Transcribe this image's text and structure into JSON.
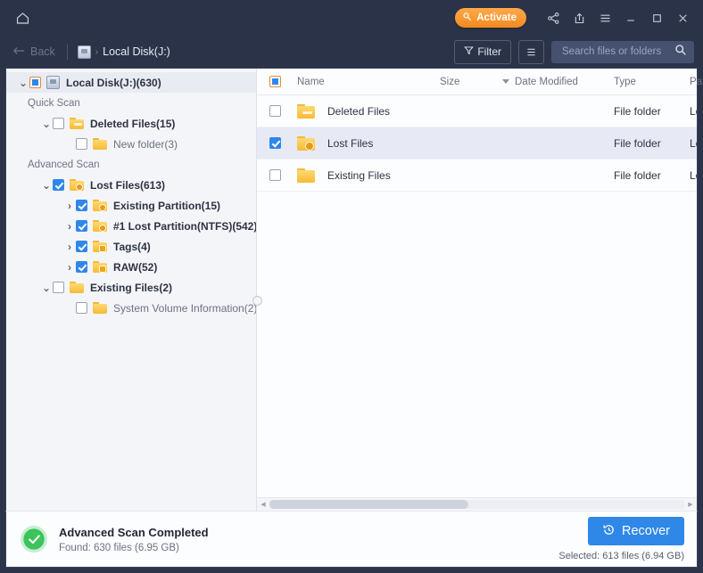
{
  "titlebar": {
    "home_icon": "home-icon",
    "activate_label": "Activate",
    "activate_icon": "key-icon",
    "activate_color": "#f58a1f",
    "share_icon": "share-icon",
    "export_icon": "upload-icon",
    "menu_icon": "hamburger-icon",
    "minimize_icon": "minimize-icon",
    "maximize_icon": "maximize-icon",
    "close_icon": "close-icon"
  },
  "toolbar": {
    "back_label": "Back",
    "back_icon": "arrow-left-icon",
    "breadcrumb": "Local Disk(J:)",
    "breadcrumb_icon": "hard-disk-icon",
    "breadcrumb_separator": "›",
    "filter_label": "Filter",
    "filter_icon": "funnel-icon",
    "view_icon": "list-view-icon",
    "search_placeholder": "Search files or folders",
    "search_value": "",
    "search_icon": "magnifier-icon"
  },
  "sidebar": {
    "root": {
      "label": "Local Disk(J:)(630)",
      "chevron": "⌄",
      "check_state": "indeterminate",
      "icon": "hard-disk-icon",
      "selected": true
    },
    "sections": [
      {
        "label": "Quick Scan",
        "items": [
          {
            "label": "Deleted Files(15)",
            "chevron": "⌄",
            "check_state": "unchecked",
            "icon": "folder-deleted-icon",
            "indent": 1,
            "bold": true
          },
          {
            "label": "New folder(3)",
            "chevron": "",
            "check_state": "unchecked",
            "icon": "folder-icon",
            "indent": 2,
            "bold": false
          }
        ]
      },
      {
        "label": "Advanced Scan",
        "items": [
          {
            "label": "Lost Files(613)",
            "chevron": "⌄",
            "check_state": "checked",
            "icon": "folder-lost-icon",
            "indent": 1,
            "bold": true
          },
          {
            "label": "Existing Partition(15)",
            "chevron": "›",
            "check_state": "checked",
            "icon": "folder-lost-icon",
            "indent": 2,
            "bold": true
          },
          {
            "label": "#1 Lost Partition(NTFS)(542)",
            "chevron": "›",
            "check_state": "checked",
            "icon": "folder-lost-icon",
            "indent": 2,
            "bold": true
          },
          {
            "label": "Tags(4)",
            "chevron": "›",
            "check_state": "checked",
            "icon": "folder-tag-icon",
            "indent": 2,
            "bold": true
          },
          {
            "label": "RAW(52)",
            "chevron": "›",
            "check_state": "checked",
            "icon": "folder-raw-icon",
            "indent": 2,
            "bold": true
          },
          {
            "label": "Existing Files(2)",
            "chevron": "⌄",
            "check_state": "unchecked",
            "icon": "folder-icon",
            "indent": 1,
            "bold": true
          },
          {
            "label": "System Volume Information(2)",
            "chevron": "",
            "check_state": "unchecked",
            "icon": "folder-icon",
            "indent": 2,
            "bold": false
          }
        ]
      }
    ]
  },
  "filelist": {
    "header_check_state": "indeterminate",
    "columns": [
      "Name",
      "Size",
      "Date Modified",
      "Type",
      "Path"
    ],
    "sort_column": "Date Modified",
    "sort_caret": "descending",
    "rows": [
      {
        "name": "Deleted Files",
        "size": "",
        "date": "",
        "type": "File folder",
        "path": "Loca",
        "checked": false,
        "selected": false,
        "icon": "folder-deleted-icon"
      },
      {
        "name": "Lost Files",
        "size": "",
        "date": "",
        "type": "File folder",
        "path": "Loca",
        "checked": true,
        "selected": true,
        "icon": "folder-lost-icon"
      },
      {
        "name": "Existing Files",
        "size": "",
        "date": "",
        "type": "File folder",
        "path": "Loca",
        "checked": false,
        "selected": false,
        "icon": "folder-icon"
      }
    ]
  },
  "statusbar": {
    "status_icon": "success-check-icon",
    "title": "Advanced Scan Completed",
    "subtitle": "Found: 630 files (6.95 GB)",
    "recover_label": "Recover",
    "recover_icon": "restore-clock-icon",
    "recover_color": "#2f87e8",
    "selected_text": "Selected: 613 files (6.94 GB)"
  }
}
